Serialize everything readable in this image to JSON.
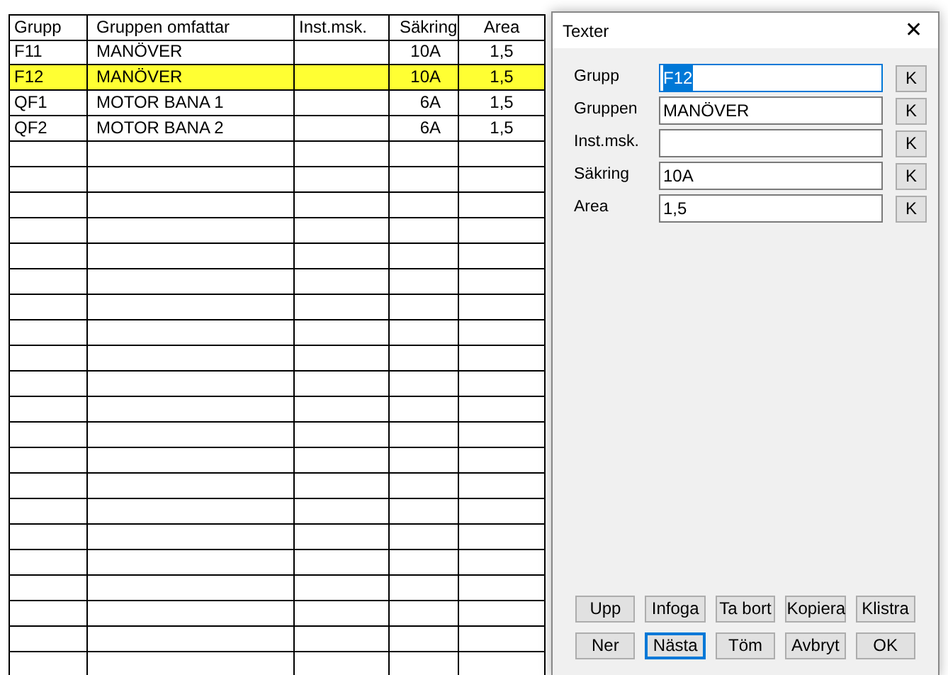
{
  "table": {
    "columns": [
      "Grupp",
      "Gruppen omfattar",
      "Inst.msk.",
      "Säkring",
      "Area"
    ],
    "rows": [
      {
        "selected": false,
        "cells": [
          "F11",
          "MANÖVER",
          null,
          "10A",
          "1,5"
        ]
      },
      {
        "selected": true,
        "cells": [
          "F12",
          "MANÖVER",
          null,
          "10A",
          "1,5"
        ]
      },
      {
        "selected": false,
        "cells": [
          "QF1",
          "MOTOR BANA 1",
          null,
          "6A",
          "1,5"
        ]
      },
      {
        "selected": false,
        "cells": [
          "QF2",
          "MOTOR BANA 2",
          null,
          "6A",
          "1,5"
        ]
      }
    ]
  },
  "dialog": {
    "title": "Texter",
    "close": "✕",
    "fields": [
      {
        "label": "Grupp",
        "value": "F12",
        "focused": true,
        "button": "K"
      },
      {
        "label": "Gruppen",
        "value": "MANÖVER",
        "focused": false,
        "button": "K"
      },
      {
        "label": "Inst.msk.",
        "focused": false,
        "button": "K"
      },
      {
        "label": "Säkring",
        "value": "10A",
        "focused": false,
        "button": "K"
      },
      {
        "label": "Area",
        "value": "1,5",
        "focused": false,
        "button": "K"
      }
    ],
    "buttons": [
      {
        "label": "Upp",
        "focused": false
      },
      {
        "label": "Infoga",
        "focused": false
      },
      {
        "label": "Ta bort",
        "focused": false
      },
      {
        "label": "Kopiera",
        "focused": false
      },
      {
        "label": "Klistra",
        "focused": false
      },
      {
        "label": "Ner",
        "focused": false
      },
      {
        "label": "Nästa",
        "focused": true
      },
      {
        "label": "Töm",
        "focused": false
      },
      {
        "label": "Avbryt",
        "focused": false
      },
      {
        "label": "OK",
        "focused": false
      }
    ]
  }
}
